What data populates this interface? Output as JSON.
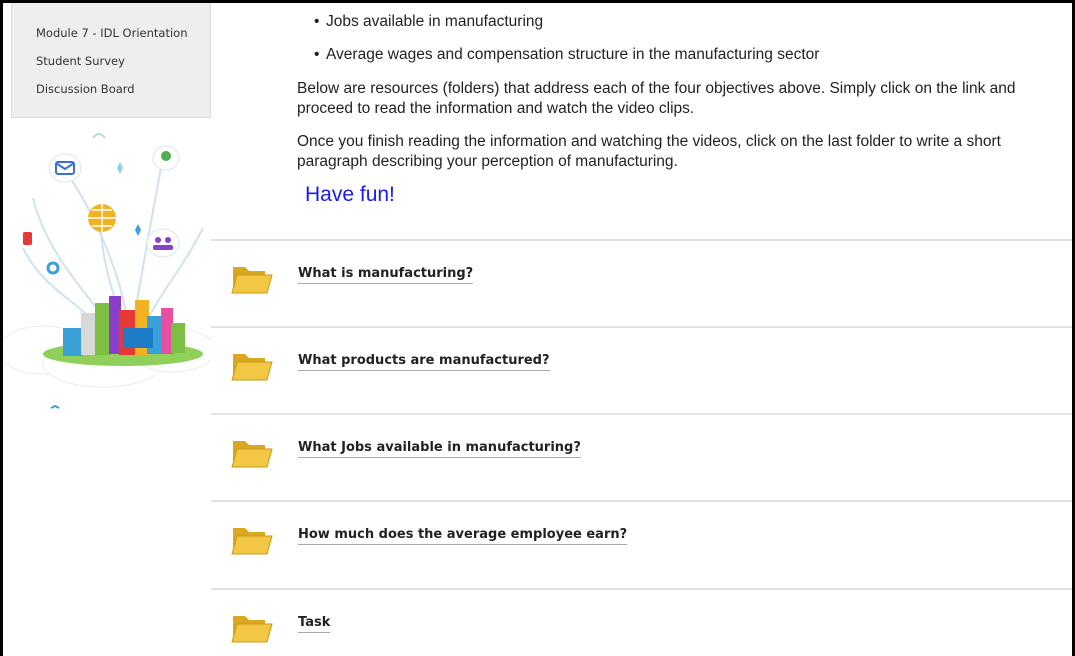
{
  "sidebar": {
    "items": [
      {
        "label": "Module 7 - IDL Orientation"
      },
      {
        "label": "Student Survey"
      },
      {
        "label": "Discussion Board"
      }
    ]
  },
  "content": {
    "bullets": [
      "Jobs available in manufacturing",
      "Average wages and compensation structure in the manufacturing sector"
    ],
    "paragraphs": [
      "Below are resources (folders) that address each of the four objectives above. Simply click on the link and proceed to read the information and watch the video clips.",
      "Once you finish reading the information and watching the videos, click on the last folder to write a short paragraph describing your perception of manufacturing."
    ],
    "have_fun": "Have fun!"
  },
  "folders": [
    {
      "title": "What is manufacturing?"
    },
    {
      "title": "What products are manufactured?"
    },
    {
      "title": "What Jobs available in manufacturing?"
    },
    {
      "title": "How much does the average employee earn?"
    },
    {
      "title": "Task"
    }
  ],
  "colors": {
    "link_accent": "#1a1af0",
    "folder": "#f2c744"
  }
}
